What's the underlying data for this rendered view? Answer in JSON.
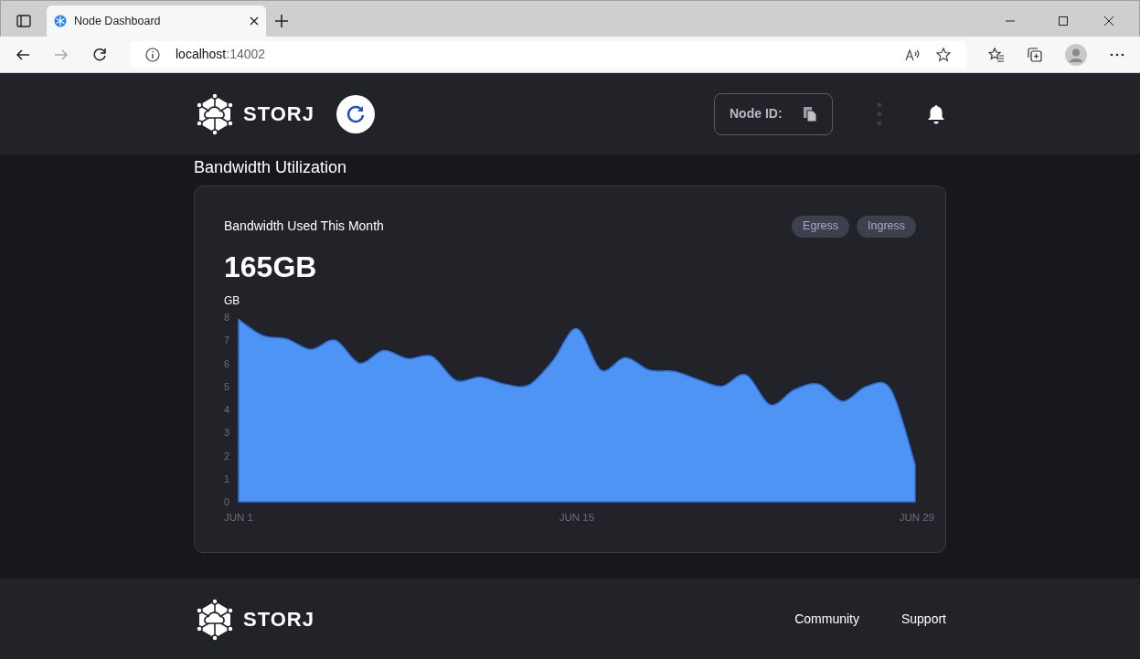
{
  "browser": {
    "tab_title": "Node Dashboard",
    "url_host": "localhost",
    "url_port": ":14002"
  },
  "header": {
    "logo_text": "STORJ",
    "node_id_label": "Node ID:"
  },
  "section_title": "Bandwidth Utilization",
  "card": {
    "title": "Bandwidth Used This Month",
    "total": "165GB",
    "toggles": [
      {
        "label": "Egress",
        "selected": false
      },
      {
        "label": "Ingress",
        "selected": false
      }
    ],
    "chart_data": {
      "type": "area",
      "ylabel": "GB",
      "categories": [
        "JUN 1",
        null,
        null,
        null,
        null,
        null,
        null,
        null,
        null,
        null,
        null,
        null,
        null,
        null,
        "JUN 15",
        null,
        null,
        null,
        null,
        null,
        null,
        null,
        null,
        null,
        null,
        null,
        null,
        null,
        "JUN 29"
      ],
      "series": [
        {
          "color": "#4d94f5",
          "values": [
            7.9,
            7.2,
            7.05,
            6.6,
            7.0,
            6.0,
            6.55,
            6.2,
            6.3,
            5.25,
            5.4,
            5.1,
            5.05,
            6.1,
            7.5,
            5.7,
            6.25,
            5.7,
            5.65,
            5.3,
            5.0,
            5.5,
            4.2,
            4.85,
            5.1,
            4.35,
            5.0,
            4.85,
            1.6
          ]
        }
      ],
      "ylim": [
        0,
        8
      ],
      "yticks": [
        0,
        1,
        2,
        3,
        4,
        5,
        6,
        7,
        8
      ]
    }
  },
  "footer": {
    "logo_text": "STORJ",
    "links": [
      "Community",
      "Support"
    ]
  }
}
